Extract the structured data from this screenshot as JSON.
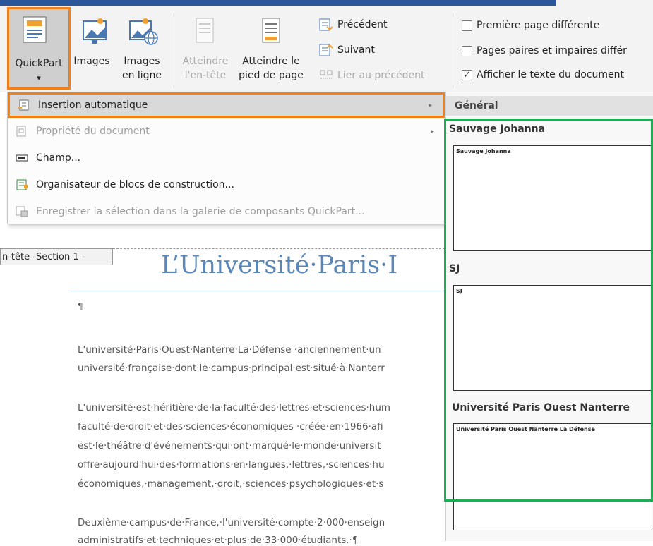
{
  "ribbon": {
    "quickpart": {
      "label": "QuickPart",
      "arrow": "▾"
    },
    "images": {
      "label": "Images"
    },
    "images_online": {
      "line1": "Images",
      "line2": "en ligne"
    },
    "goto_header": {
      "line1": "Atteindre",
      "line2": "l'en-tête"
    },
    "goto_footer": {
      "line1": "Atteindre le",
      "line2": "pied de page"
    },
    "previous": "Précédent",
    "next": "Suivant",
    "link_previous": "Lier au précédent",
    "options": [
      {
        "label": "Première page différente",
        "checked": false
      },
      {
        "label": "Pages paires et impaires différ",
        "checked": false
      },
      {
        "label": "Afficher le texte du document",
        "checked": true
      }
    ],
    "check_mark": "✓"
  },
  "menu": {
    "items": [
      {
        "label": "Insertion automatique",
        "has_submenu": true,
        "enabled": true,
        "highlighted": true,
        "icon": "autotext-icon"
      },
      {
        "label": "Propriété du document",
        "has_submenu": true,
        "enabled": false,
        "icon": "doc-property-icon"
      },
      {
        "label": "Champ...",
        "has_submenu": false,
        "enabled": true,
        "icon": "field-icon"
      },
      {
        "label": "Organisateur de blocs de construction...",
        "has_submenu": false,
        "enabled": true,
        "icon": "building-blocks-icon"
      },
      {
        "label": "Enregistrer la sélection dans la galerie de composants QuickPart...",
        "has_submenu": false,
        "enabled": false,
        "icon": "save-selection-icon"
      }
    ],
    "submenu_arrow": "▸"
  },
  "gallery": {
    "heading": "Général",
    "entries": [
      {
        "title": "Sauvage Johanna",
        "preview": "Sauvage Johanna"
      },
      {
        "title": "SJ",
        "preview": "SJ"
      },
      {
        "title": "Université Paris Ouest Nanterre",
        "preview": "Université Paris Ouest Nanterre La Défense"
      }
    ]
  },
  "document": {
    "header_tab": "n-tête -Section 1 -",
    "title": "L’Université·Paris·I",
    "pilcrow": "¶",
    "lines": [
      "L'université·Paris·Ouest·Nanterre·La·Défense  ·anciennement·un",
      "université·française·dont·le·campus·principal·est·situé·à·Nanterr",
      "L'université·est·héritière·de·la·faculté·des·lettres·et·sciences·hum",
      "faculté·de·droit·et·des·sciences·économiques  ·créée·en·1966·afi",
      "est·le·théâtre·d'événements·qui·ont·marqué·le·monde·universit",
      "offre·aujourd'hui·des·formations·en·langues,·lettres,·sciences·hu",
      "économiques,·management,·droit,·sciences·psychologiques·et·s",
      "Deuxième·campus·de·France,·l'université·compte·2·000·enseign",
      "administratifs·et·techniques·et·plus·de·33·000·étudiants.·¶"
    ]
  },
  "colors": {
    "accent_orange": "#f0801c",
    "accent_green": "#22aa55",
    "title_blue": "#5b87b8"
  }
}
